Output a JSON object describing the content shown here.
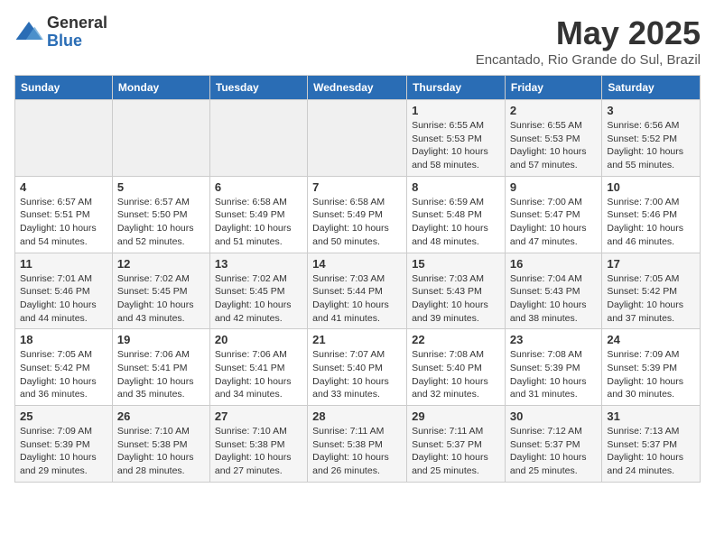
{
  "logo": {
    "general": "General",
    "blue": "Blue"
  },
  "title": "May 2025",
  "subtitle": "Encantado, Rio Grande do Sul, Brazil",
  "days_of_week": [
    "Sunday",
    "Monday",
    "Tuesday",
    "Wednesday",
    "Thursday",
    "Friday",
    "Saturday"
  ],
  "weeks": [
    [
      {
        "day": "",
        "info": ""
      },
      {
        "day": "",
        "info": ""
      },
      {
        "day": "",
        "info": ""
      },
      {
        "day": "",
        "info": ""
      },
      {
        "day": "1",
        "info": "Sunrise: 6:55 AM\nSunset: 5:53 PM\nDaylight: 10 hours and 58 minutes."
      },
      {
        "day": "2",
        "info": "Sunrise: 6:55 AM\nSunset: 5:53 PM\nDaylight: 10 hours and 57 minutes."
      },
      {
        "day": "3",
        "info": "Sunrise: 6:56 AM\nSunset: 5:52 PM\nDaylight: 10 hours and 55 minutes."
      }
    ],
    [
      {
        "day": "4",
        "info": "Sunrise: 6:57 AM\nSunset: 5:51 PM\nDaylight: 10 hours and 54 minutes."
      },
      {
        "day": "5",
        "info": "Sunrise: 6:57 AM\nSunset: 5:50 PM\nDaylight: 10 hours and 52 minutes."
      },
      {
        "day": "6",
        "info": "Sunrise: 6:58 AM\nSunset: 5:49 PM\nDaylight: 10 hours and 51 minutes."
      },
      {
        "day": "7",
        "info": "Sunrise: 6:58 AM\nSunset: 5:49 PM\nDaylight: 10 hours and 50 minutes."
      },
      {
        "day": "8",
        "info": "Sunrise: 6:59 AM\nSunset: 5:48 PM\nDaylight: 10 hours and 48 minutes."
      },
      {
        "day": "9",
        "info": "Sunrise: 7:00 AM\nSunset: 5:47 PM\nDaylight: 10 hours and 47 minutes."
      },
      {
        "day": "10",
        "info": "Sunrise: 7:00 AM\nSunset: 5:46 PM\nDaylight: 10 hours and 46 minutes."
      }
    ],
    [
      {
        "day": "11",
        "info": "Sunrise: 7:01 AM\nSunset: 5:46 PM\nDaylight: 10 hours and 44 minutes."
      },
      {
        "day": "12",
        "info": "Sunrise: 7:02 AM\nSunset: 5:45 PM\nDaylight: 10 hours and 43 minutes."
      },
      {
        "day": "13",
        "info": "Sunrise: 7:02 AM\nSunset: 5:45 PM\nDaylight: 10 hours and 42 minutes."
      },
      {
        "day": "14",
        "info": "Sunrise: 7:03 AM\nSunset: 5:44 PM\nDaylight: 10 hours and 41 minutes."
      },
      {
        "day": "15",
        "info": "Sunrise: 7:03 AM\nSunset: 5:43 PM\nDaylight: 10 hours and 39 minutes."
      },
      {
        "day": "16",
        "info": "Sunrise: 7:04 AM\nSunset: 5:43 PM\nDaylight: 10 hours and 38 minutes."
      },
      {
        "day": "17",
        "info": "Sunrise: 7:05 AM\nSunset: 5:42 PM\nDaylight: 10 hours and 37 minutes."
      }
    ],
    [
      {
        "day": "18",
        "info": "Sunrise: 7:05 AM\nSunset: 5:42 PM\nDaylight: 10 hours and 36 minutes."
      },
      {
        "day": "19",
        "info": "Sunrise: 7:06 AM\nSunset: 5:41 PM\nDaylight: 10 hours and 35 minutes."
      },
      {
        "day": "20",
        "info": "Sunrise: 7:06 AM\nSunset: 5:41 PM\nDaylight: 10 hours and 34 minutes."
      },
      {
        "day": "21",
        "info": "Sunrise: 7:07 AM\nSunset: 5:40 PM\nDaylight: 10 hours and 33 minutes."
      },
      {
        "day": "22",
        "info": "Sunrise: 7:08 AM\nSunset: 5:40 PM\nDaylight: 10 hours and 32 minutes."
      },
      {
        "day": "23",
        "info": "Sunrise: 7:08 AM\nSunset: 5:39 PM\nDaylight: 10 hours and 31 minutes."
      },
      {
        "day": "24",
        "info": "Sunrise: 7:09 AM\nSunset: 5:39 PM\nDaylight: 10 hours and 30 minutes."
      }
    ],
    [
      {
        "day": "25",
        "info": "Sunrise: 7:09 AM\nSunset: 5:39 PM\nDaylight: 10 hours and 29 minutes."
      },
      {
        "day": "26",
        "info": "Sunrise: 7:10 AM\nSunset: 5:38 PM\nDaylight: 10 hours and 28 minutes."
      },
      {
        "day": "27",
        "info": "Sunrise: 7:10 AM\nSunset: 5:38 PM\nDaylight: 10 hours and 27 minutes."
      },
      {
        "day": "28",
        "info": "Sunrise: 7:11 AM\nSunset: 5:38 PM\nDaylight: 10 hours and 26 minutes."
      },
      {
        "day": "29",
        "info": "Sunrise: 7:11 AM\nSunset: 5:37 PM\nDaylight: 10 hours and 25 minutes."
      },
      {
        "day": "30",
        "info": "Sunrise: 7:12 AM\nSunset: 5:37 PM\nDaylight: 10 hours and 25 minutes."
      },
      {
        "day": "31",
        "info": "Sunrise: 7:13 AM\nSunset: 5:37 PM\nDaylight: 10 hours and 24 minutes."
      }
    ]
  ]
}
